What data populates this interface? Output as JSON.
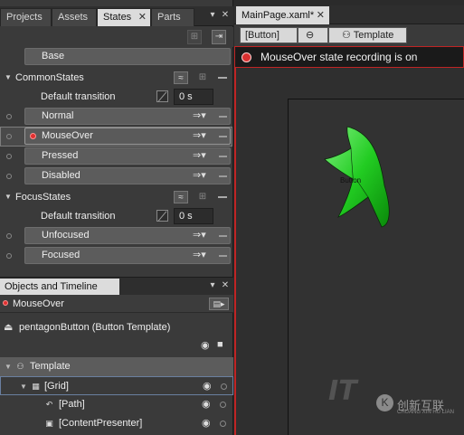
{
  "left_tabs": [
    {
      "label": "Projects",
      "active": false,
      "closable": false
    },
    {
      "label": "Assets",
      "active": false,
      "closable": false
    },
    {
      "label": "States",
      "active": true,
      "closable": true
    },
    {
      "label": "Parts",
      "active": false,
      "closable": false
    }
  ],
  "states_panel": {
    "base_label": "Base",
    "groups": [
      {
        "name": "CommonStates",
        "default_transition_label": "Default transition",
        "default_transition_value": "0 s",
        "states": [
          "Normal",
          "MouseOver",
          "Pressed",
          "Disabled"
        ]
      },
      {
        "name": "FocusStates",
        "default_transition_label": "Default transition",
        "default_transition_value": "0 s",
        "states": [
          "Unfocused",
          "Focused"
        ]
      }
    ],
    "selected_state": "MouseOver"
  },
  "objects_timeline": {
    "title": "Objects and Timeline",
    "current_state": "MouseOver",
    "scope_label": "pentagonButton (Button Template)",
    "tree": [
      {
        "label": "Template",
        "level": 0
      },
      {
        "label": "[Grid]",
        "level": 1
      },
      {
        "label": "[Path]",
        "level": 2
      },
      {
        "label": "[ContentPresenter]",
        "level": 2
      }
    ]
  },
  "document": {
    "tab_label": "MainPage.xaml*",
    "breadcrumbs": [
      "[Button]",
      "Template"
    ],
    "recording_message": "MouseOver state recording is on",
    "canvas_button_text": "Button",
    "shape_fill_color": "#22cc22",
    "recording_color": "#c02424"
  },
  "watermark": {
    "logo_text": "IT",
    "badge_glyph": "K",
    "cn_text": "创新互联",
    "en_text": "CHUANG XIN HU LIAN"
  }
}
